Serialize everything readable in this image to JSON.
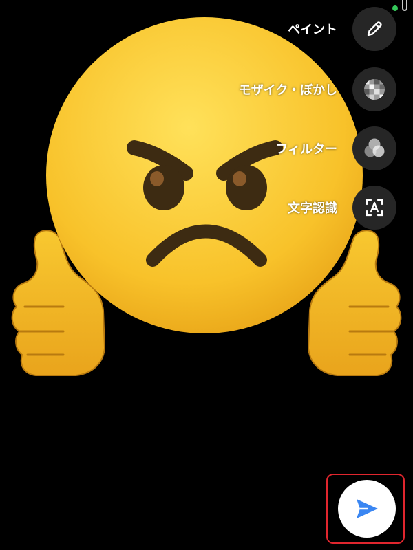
{
  "colors": {
    "background": "#000000",
    "tool_button_bg": "#262626",
    "status_dot": "#34c759",
    "send_accent": "#3a86f2",
    "highlight_border": "#e0262e"
  },
  "image_content": {
    "emoji": "angry-face-with-thumbs-up"
  },
  "tools": [
    {
      "label": "ペイント",
      "icon": "pencil-icon"
    },
    {
      "label": "モザイク・ぼかし",
      "icon": "mosaic-blur-icon"
    },
    {
      "label": "フィルター",
      "icon": "filter-icon"
    },
    {
      "label": "文字認識",
      "icon": "text-recognition-icon"
    }
  ],
  "send": {
    "icon": "send-icon"
  }
}
